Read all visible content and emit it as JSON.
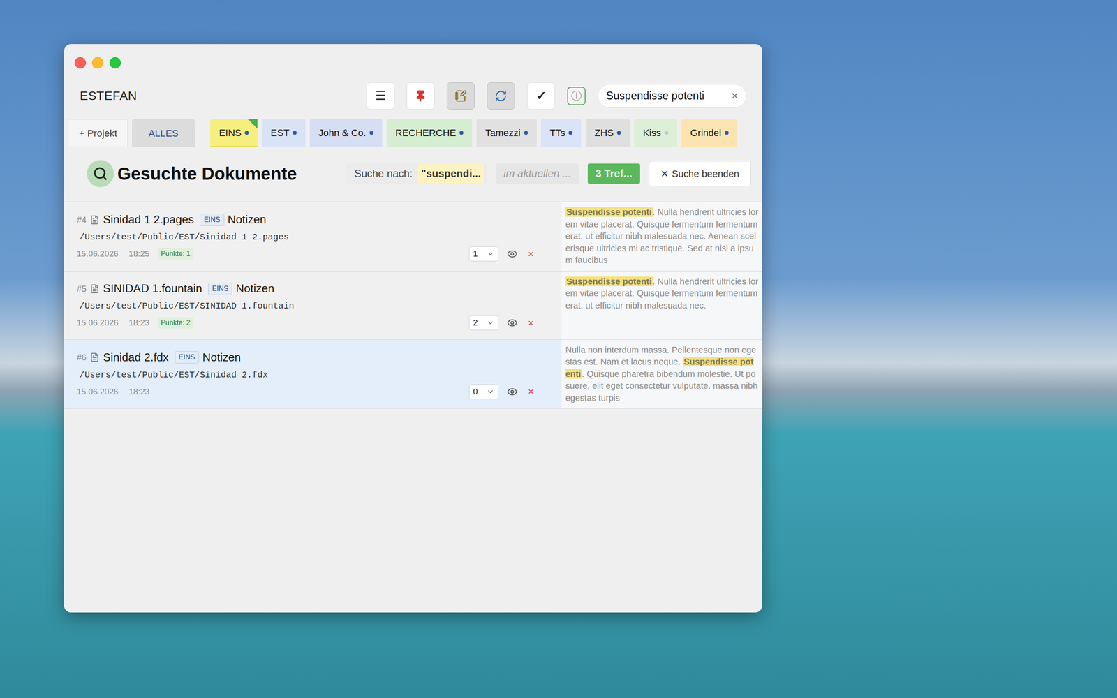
{
  "window": {
    "title": "ESTEFAN"
  },
  "toolbar": {
    "buttons": [
      {
        "kind": "menu",
        "label": "☰",
        "selected": false
      },
      {
        "kind": "pin",
        "selected": false
      },
      {
        "kind": "notes",
        "selected": true
      },
      {
        "kind": "refresh",
        "selected": true
      },
      {
        "kind": "check",
        "label": "✓",
        "selected": false
      },
      {
        "kind": "info",
        "label": "ⓘ",
        "selected": false
      }
    ],
    "search": {
      "value": "Suspendisse potenti",
      "clear": "×"
    }
  },
  "project_bar": {
    "add_button": "+ Projekt",
    "all_button": "ALLES",
    "tabs": [
      {
        "label": "EINS",
        "color": "#f6ef7e",
        "dot_color": "#2f5aa8",
        "selected": true
      },
      {
        "label": "EST",
        "color": "#d9e3f6",
        "dot_color": "#2f5aa8",
        "selected": false
      },
      {
        "label": "John & Co.",
        "color": "#d6def4",
        "dot_color": "#2f5aa8",
        "selected": false
      },
      {
        "label": "RECHERCHE",
        "color": "#d5edd1",
        "dot_color": "#2f5aa8",
        "selected": false
      },
      {
        "label": "Tamezzi",
        "color": "#e1e1e1",
        "dot_color": "#2f5aa8",
        "selected": false
      },
      {
        "label": "TTs",
        "color": "#dae4f8",
        "dot_color": "#2f5aa8",
        "selected": false
      },
      {
        "label": "ZHS",
        "color": "#dfdfdf",
        "dot_color": "#2f5aa8",
        "selected": false
      },
      {
        "label": "Kiss",
        "color": "#ddefd7",
        "dot_color": "#c9c9c9",
        "selected": false
      },
      {
        "label": "Grindel",
        "color": "#fce4b2",
        "dot_color": "#2f5aa8",
        "selected": false
      }
    ]
  },
  "search_header": {
    "title": "Gesuchte Dokumente",
    "search_label": "Suche nach:",
    "query": "\"suspendi...",
    "scope": "im aktuellen ...",
    "count": "3 Tref...",
    "close_icon": "✕",
    "close_label": "Suche beenden"
  },
  "results": [
    {
      "number": "#4",
      "name": "Sinidad 1 2.pages",
      "project": "EINS",
      "category": "Notizen",
      "path": "/Users/test/Public/EST/Sinidad 1 2.pages",
      "date": "15.06.2026",
      "time": "18:25",
      "points": "Punkte: 1",
      "rating": "1",
      "delete": "×",
      "selected": false,
      "snippet": [
        {
          "text": "Suspendisse potenti",
          "highlight": true
        },
        {
          "text": ". Nulla hendrerit ultricies lorem vitae placerat. Quisque fermentum fermentum erat, ut efficitur nibh malesuada nec. Aenean scelerisque ultricies mi ac tristique. Sed at nisl a ipsum faucibus",
          "highlight": false
        }
      ]
    },
    {
      "number": "#5",
      "name": "SINIDAD 1.fountain",
      "project": "EINS",
      "category": "Notizen",
      "path": "/Users/test/Public/EST/SINIDAD 1.fountain",
      "date": "15.06.2026",
      "time": "18:23",
      "points": "Punkte: 2",
      "rating": "2",
      "delete": "×",
      "selected": false,
      "snippet": [
        {
          "text": "Suspendisse potenti",
          "highlight": true
        },
        {
          "text": ". Nulla hendrerit ultricies lorem vitae placerat. Quisque fermentum fermentum erat, ut efficitur nibh malesuada nec.",
          "highlight": false
        }
      ]
    },
    {
      "number": "#6",
      "name": "Sinidad 2.fdx",
      "project": "EINS",
      "category": "Notizen",
      "path": "/Users/test/Public/EST/Sinidad 2.fdx",
      "date": "15.06.2026",
      "time": "18:23",
      "points": "",
      "rating": "0",
      "delete": "×",
      "selected": true,
      "snippet": [
        {
          "text": "Nulla non interdum massa. Pellentesque non egestas est. Nam et lacus neque. ",
          "highlight": false
        },
        {
          "text": "Suspendisse potenti",
          "highlight": true
        },
        {
          "text": ". Quisque pharetra bibendum molestie. Ut posuere, elit eget consectetur vulputate, massa nibh egestas turpis",
          "highlight": false
        }
      ]
    }
  ]
}
